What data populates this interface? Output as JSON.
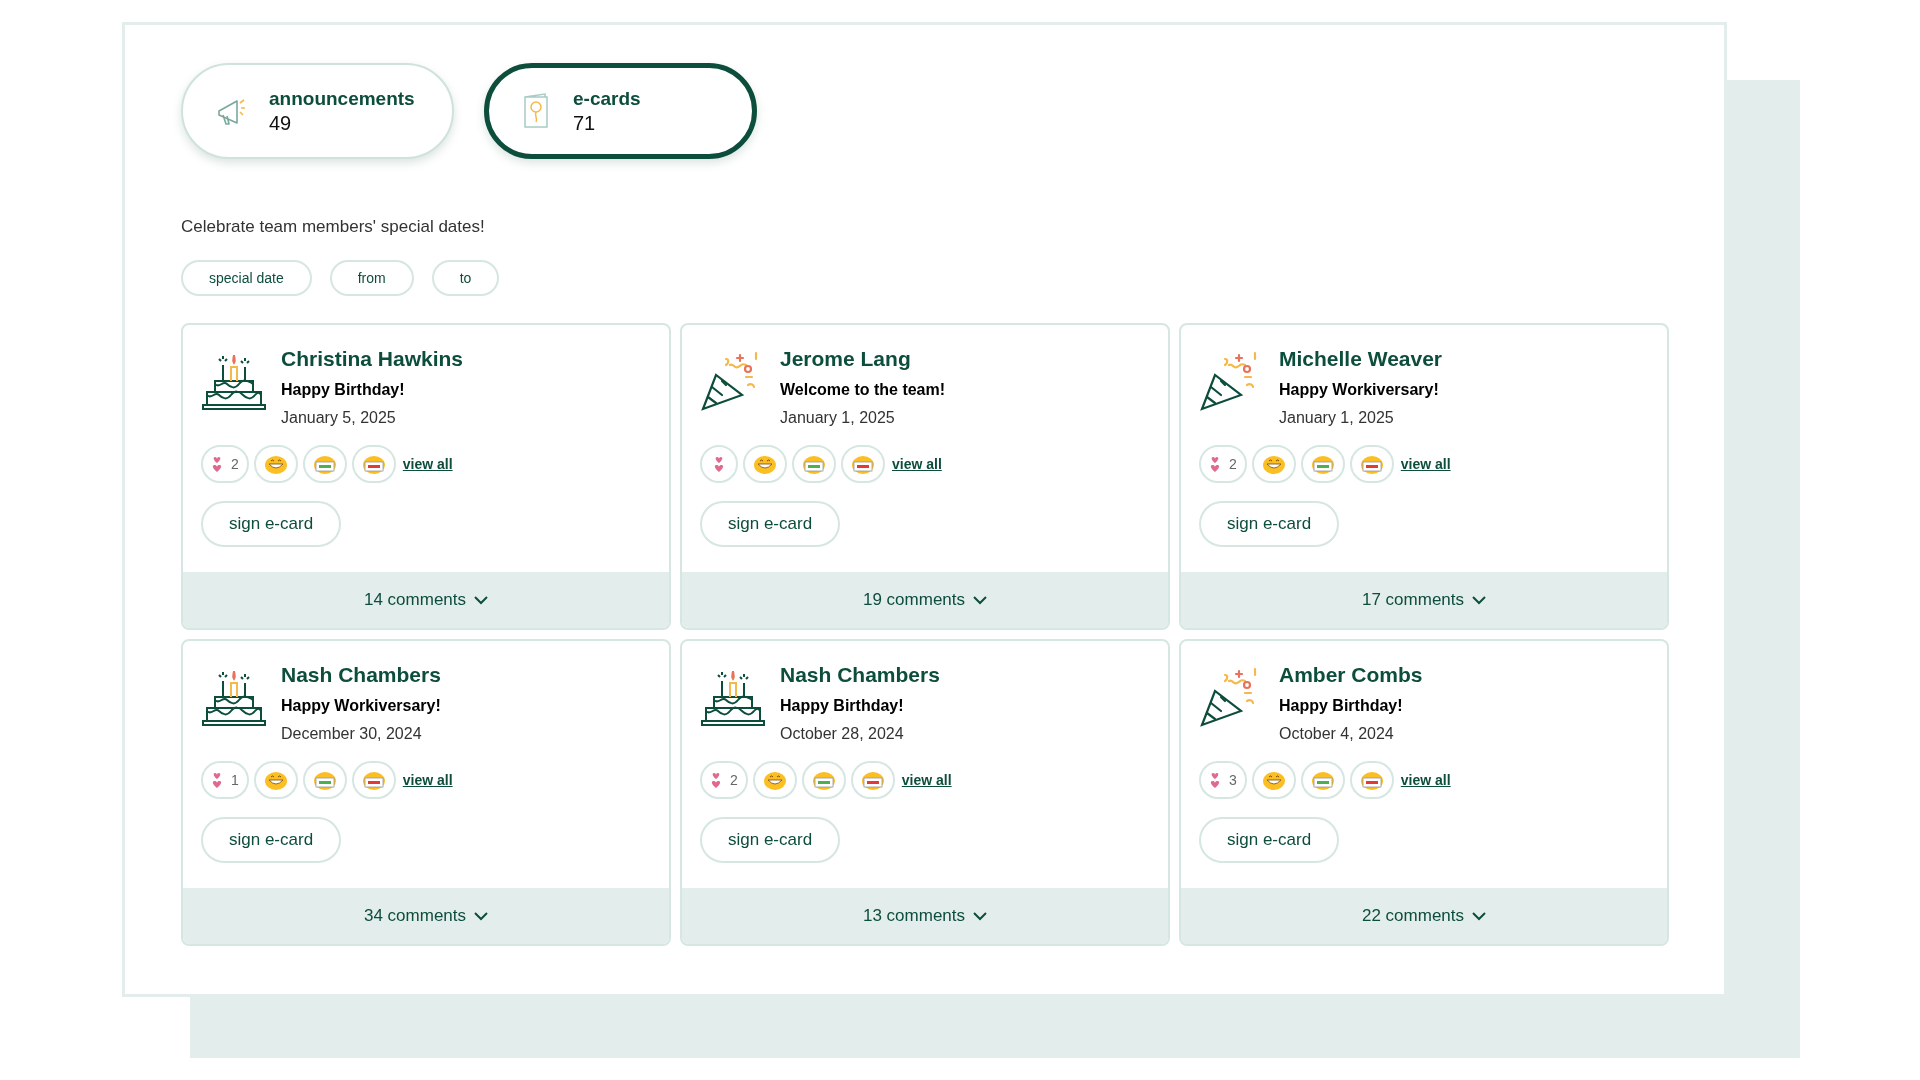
{
  "tabs": [
    {
      "kind": "megaphone",
      "label": "announcements",
      "count": "49",
      "selected": false
    },
    {
      "kind": "card",
      "label": "e-cards",
      "count": "71",
      "selected": true
    }
  ],
  "description": "Celebrate team members' special dates!",
  "filters": [
    "special date",
    "from",
    "to"
  ],
  "cards": [
    {
      "kind": "cake",
      "name": "Christina Hawkins",
      "occasion": "Happy Birthday!",
      "date": "January 5, 2025",
      "hearts": "2",
      "view_all": "view all",
      "button": "sign e-card",
      "comments": "14 comments"
    },
    {
      "kind": "party",
      "name": "Jerome Lang",
      "occasion": "Welcome to the team!",
      "date": "January 1, 2025",
      "view_all": "view all",
      "button": "sign e-card",
      "comments": "19 comments"
    },
    {
      "kind": "party",
      "name": "Michelle Weaver",
      "occasion": "Happy Workiversary!",
      "date": "January 1, 2025",
      "hearts": "2",
      "view_all": "view all",
      "button": "sign e-card",
      "comments": "17 comments"
    },
    {
      "kind": "cake",
      "name": "Nash Chambers",
      "occasion": "Happy Workiversary!",
      "date": "December 30, 2024",
      "hearts": "1",
      "view_all": "view all",
      "button": "sign e-card",
      "comments": "34 comments"
    },
    {
      "kind": "cake",
      "name": "Nash Chambers",
      "occasion": "Happy Birthday!",
      "date": "October 28, 2024",
      "hearts": "2",
      "view_all": "view all",
      "button": "sign e-card",
      "comments": "13 comments"
    },
    {
      "kind": "party",
      "name": "Amber Combs",
      "occasion": "Happy Birthday!",
      "date": "October 4, 2024",
      "hearts": "3",
      "view_all": "view all",
      "button": "sign e-card",
      "comments": "22 comments"
    }
  ]
}
